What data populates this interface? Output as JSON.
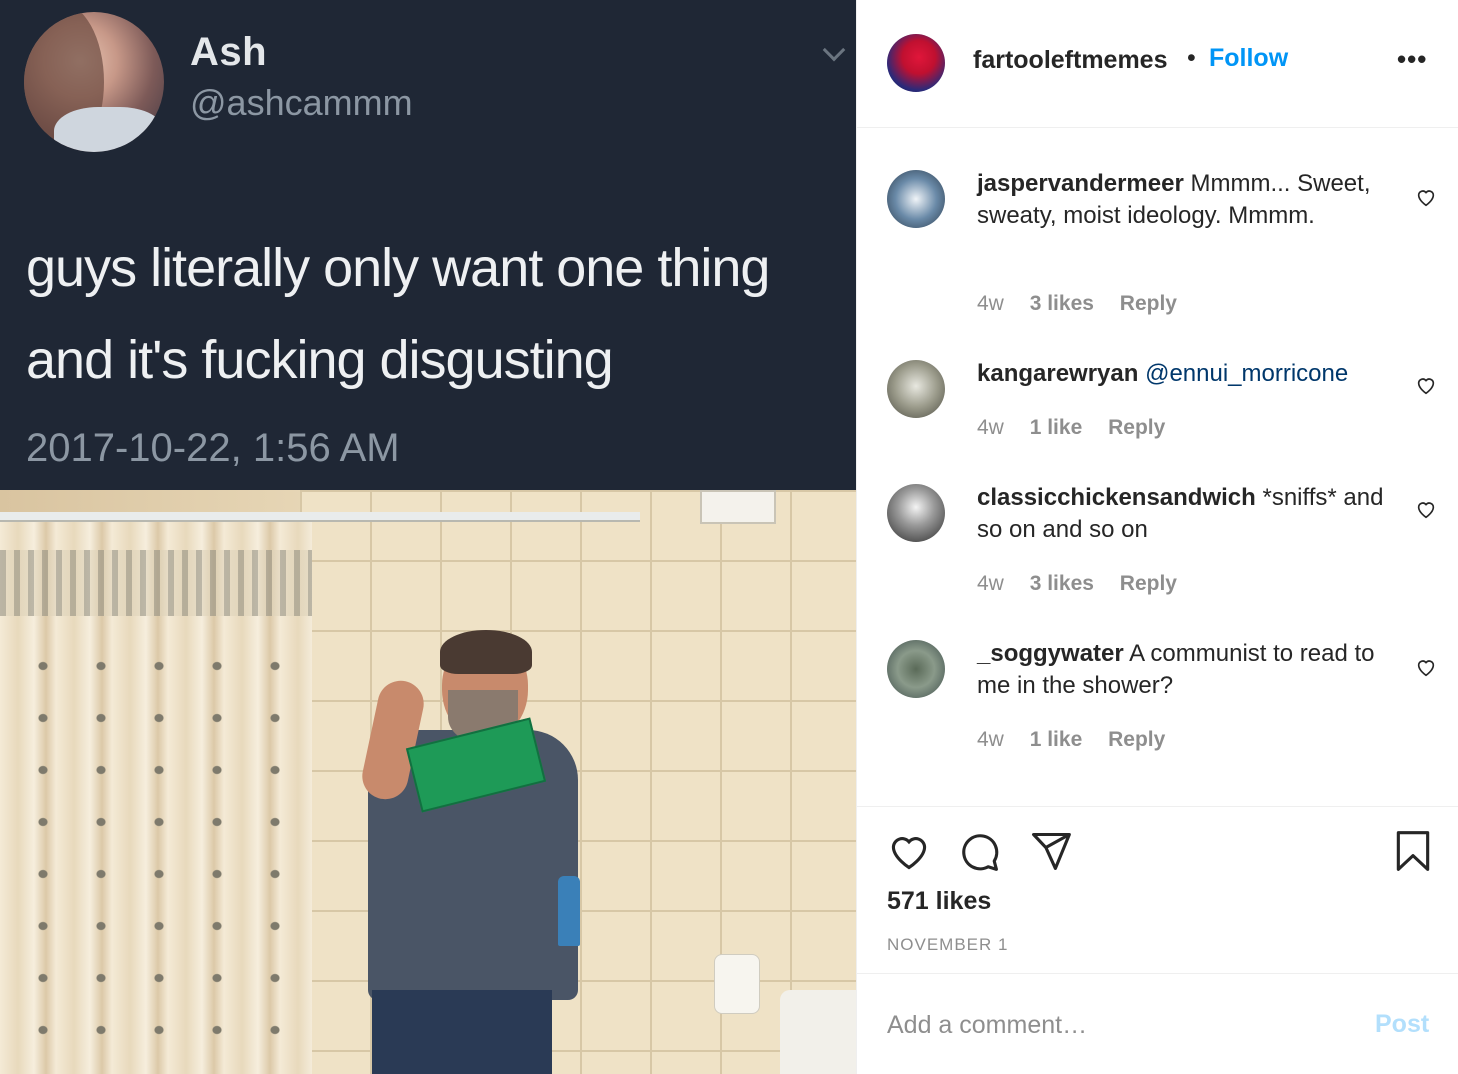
{
  "post_image": {
    "tweet": {
      "name": "Ash",
      "handle": "@ashcammm",
      "text_line1": "guys literally only want one thing",
      "text_line2": "and it's fucking disgusting",
      "timestamp": "2017-10-22, 1:56 AM"
    }
  },
  "header": {
    "username": "fartooleftmemes",
    "separator": "•",
    "follow_label": "Follow",
    "more_label": "•••"
  },
  "comments": [
    {
      "username": "jaspervandermeer",
      "text": "Mmmm... Sweet, sweaty, moist ideology. Mmmm.",
      "mention": "",
      "age": "4w",
      "likes": "3 likes",
      "reply_label": "Reply"
    },
    {
      "username": "kangarewryan",
      "text": "",
      "mention": "@ennui_morricone",
      "age": "4w",
      "likes": "1 like",
      "reply_label": "Reply"
    },
    {
      "username": "classicchickensandwich",
      "text": "*sniffs* and so on and so on",
      "mention": "",
      "age": "4w",
      "likes": "3 likes",
      "reply_label": "Reply"
    },
    {
      "username": "_soggywater",
      "text": "A communist to read to me in the shower?",
      "mention": "",
      "age": "4w",
      "likes": "1 like",
      "reply_label": "Reply"
    }
  ],
  "actions": {
    "like_count": "571 likes",
    "date": "NOVEMBER 1"
  },
  "add_comment": {
    "placeholder": "Add a comment…",
    "post_label": "Post"
  },
  "colors": {
    "follow_blue": "#0095f6",
    "post_disabled": "#b2dffc",
    "meta_gray": "#8e8e8e",
    "mention_blue": "#00376b"
  }
}
